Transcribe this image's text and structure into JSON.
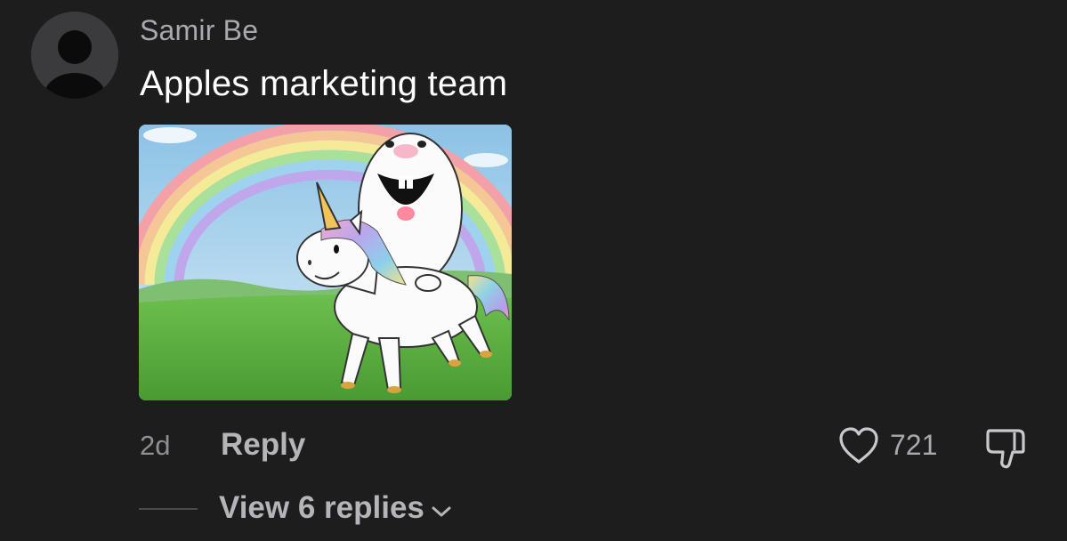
{
  "comment": {
    "username": "Samir Be",
    "text": "Apples marketing team",
    "time": "2d",
    "reply_label": "Reply",
    "like_count": "721",
    "view_replies_label": "View 6 replies"
  },
  "icons": {
    "avatar": "default-user-avatar",
    "like": "heart-outline-icon",
    "dislike": "thumbs-down-outline-icon",
    "chevron": "chevron-down-icon"
  },
  "colors": {
    "background": "#1d1d1e",
    "username": "#a9a9ad",
    "text": "#ffffff",
    "secondary": "#b5b5b9"
  }
}
